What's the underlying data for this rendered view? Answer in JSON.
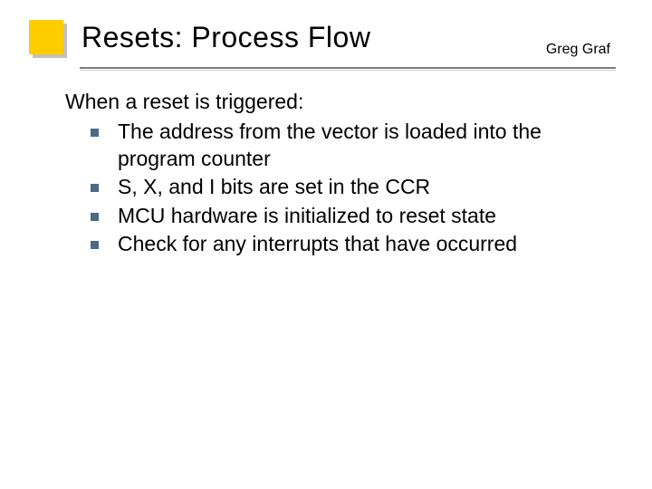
{
  "title": "Resets: Process Flow",
  "author": "Greg Graf",
  "lead": "When a reset is triggered:",
  "bullets": [
    "The address from the vector is loaded into the program counter",
    "S, X, and I bits are set in the CCR",
    "MCU hardware is initialized to reset state",
    "Check for any interrupts that have occurred"
  ]
}
